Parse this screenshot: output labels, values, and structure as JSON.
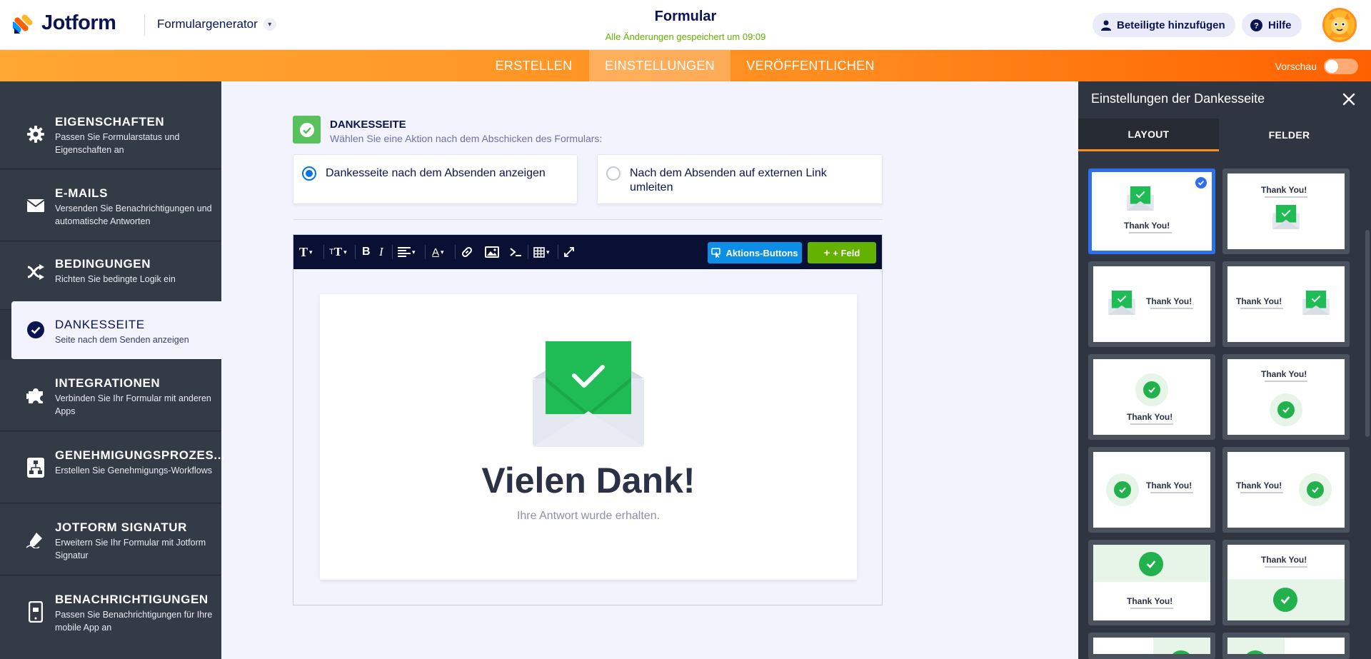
{
  "header": {
    "logo_text": "Jotform",
    "builder_label": "Formulargenerator",
    "form_title": "Formular",
    "saved_note": "Alle Änderungen gespeichert um 09:09",
    "add_participants": "Beteiligte hinzufügen",
    "help": "Hilfe"
  },
  "nav": {
    "tabs": [
      {
        "label": "ERSTELLEN",
        "active": false
      },
      {
        "label": "EINSTELLUNGEN",
        "active": true
      },
      {
        "label": "VERÖFFENTLICHEN",
        "active": false
      }
    ],
    "preview_label": "Vorschau"
  },
  "sidebar": {
    "items": [
      {
        "title": "EIGENSCHAFTEN",
        "desc": "Passen Sie Formularstatus und Eigenschaften an",
        "icon": "gear-icon"
      },
      {
        "title": "E-MAILS",
        "desc": "Versenden Sie Benachrichtigungen und automatische Antworten",
        "icon": "envelope-icon"
      },
      {
        "title": "BEDINGUNGEN",
        "desc": "Richten Sie bedingte Logik ein",
        "icon": "shuffle-icon"
      },
      {
        "title": "DANKESSEITE",
        "desc": "Seite nach dem Senden anzeigen",
        "icon": "check-circle-icon",
        "active": true
      },
      {
        "title": "INTEGRATIONEN",
        "desc": "Verbinden Sie Ihr Formular mit anderen Apps",
        "icon": "puzzle-icon"
      },
      {
        "title": "GENEHMIGUNGSPROZES...",
        "desc": "Erstellen Sie Genehmigungs-Workflows",
        "icon": "workflow-icon"
      },
      {
        "title": "JOTFORM SIGNATUR",
        "desc": "Erweitern Sie Ihr Formular mit Jotform Signatur",
        "icon": "pen-icon"
      },
      {
        "title": "BENACHRICHTIGUNGEN",
        "desc": "Passen Sie Benachrichtigungen für Ihre mobile App an",
        "icon": "phone-icon"
      }
    ]
  },
  "section": {
    "title": "DANKESSEITE",
    "subtitle": "Wählen Sie eine Aktion nach dem Abschicken des Formulars:",
    "options": [
      {
        "label": "Dankesseite nach dem Absenden anzeigen",
        "selected": true
      },
      {
        "label": "Nach dem Absenden auf externen Link umleiten",
        "selected": false
      }
    ]
  },
  "editor": {
    "action_buttons": "Aktions-Buttons",
    "add_field": "+ Feld",
    "heading": "Vielen Dank!",
    "message": "Ihre Antwort wurde erhalten."
  },
  "right_panel": {
    "title": "Einstellungen der Dankesseite",
    "tabs": [
      {
        "label": "LAYOUT",
        "active": true
      },
      {
        "label": "FELDER",
        "active": false
      }
    ],
    "thumb_title": "Thank You!"
  },
  "colors": {
    "brand_orange": "#ff8d1f",
    "success_green": "#22b14c",
    "saved_green": "#64b200",
    "navy": "#0a1551",
    "sidebar_bg": "#333b47",
    "selected_blue": "#2e6fee"
  }
}
